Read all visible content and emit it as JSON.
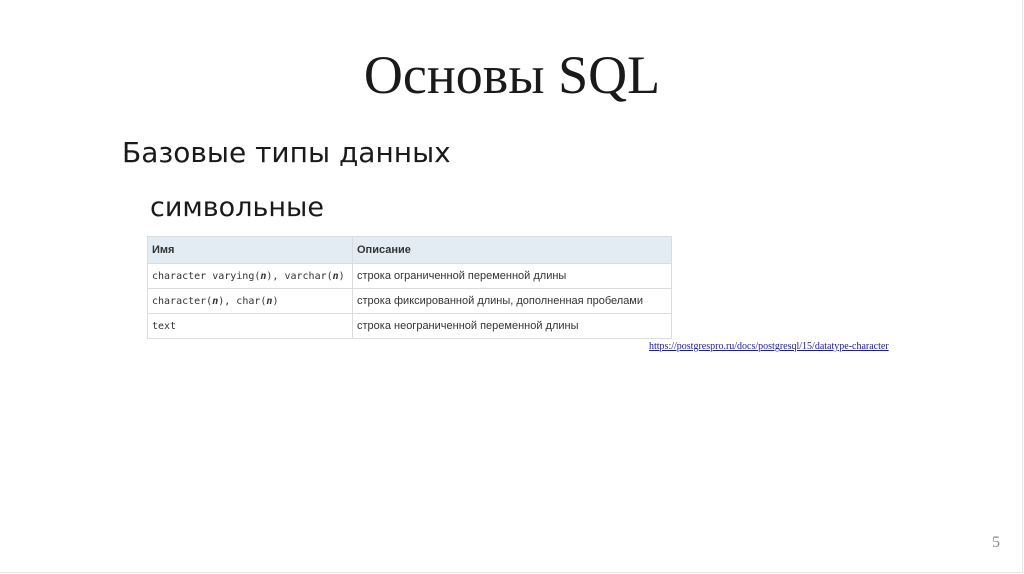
{
  "slide": {
    "title": "Основы SQL",
    "subtitle": "Базовые типы данных",
    "section": "символьные",
    "page_number": "5"
  },
  "table": {
    "headers": [
      "Имя",
      "Описание"
    ],
    "rows": [
      {
        "name_parts": [
          "character varying(",
          "n",
          "), varchar(",
          "n",
          ")"
        ],
        "description": "строка ограниченной переменной длины"
      },
      {
        "name_parts": [
          "character(",
          "n",
          "), char(",
          "n",
          ")"
        ],
        "description": "строка фиксированной длины, дополненная пробелами"
      },
      {
        "name_parts": [
          "text"
        ],
        "description": "строка неограниченной переменной длины"
      }
    ]
  },
  "source": {
    "link_text": "https://postgrespro.ru/docs/postgresql/15/datatype-character"
  }
}
